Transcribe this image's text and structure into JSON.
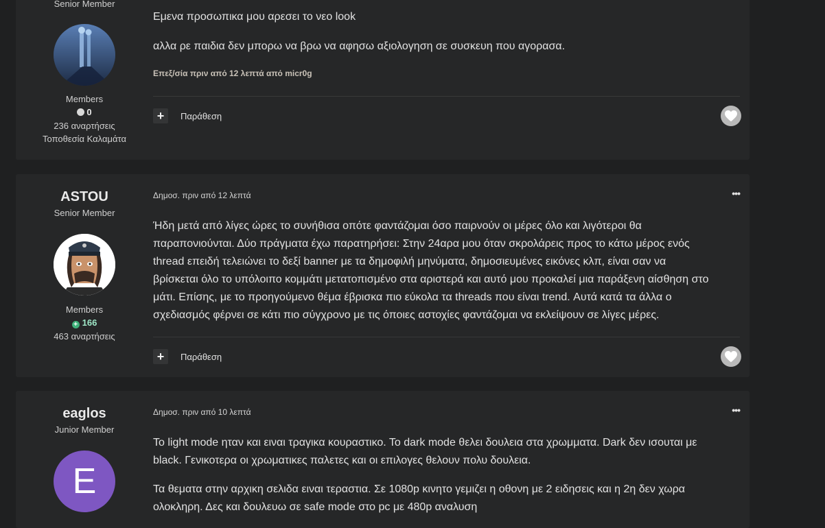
{
  "posts": [
    {
      "author": {
        "title": "Senior Member",
        "group": "Members",
        "rep": "0",
        "posts_count": "236 αναρτήσεις",
        "location": "Τοποθεσία Καλαμάτα"
      },
      "body": [
        "Εμενα προσωπικα μου αρεσει το νεο look",
        "αλλα ρε παιδια δεν μπορω να βρω να αφησω αξιολογηση σε συσκευη που αγορασα."
      ],
      "edited": "Επεξ/σία πριν από 12 λεπτά από micr0g",
      "quote_label": "Παράθεση"
    },
    {
      "author": {
        "name": "ASTOU",
        "title": "Senior Member",
        "group": "Members",
        "rep": "166",
        "posts_count": "463 αναρτήσεις"
      },
      "meta": "Δημοσ. πριν από 12 λεπτά",
      "body_lines": [
        "Ήδη μετά από λίγες ώρες το συνήθισα οπότε φαντάζομαι όσο παιρνούν οι μέρες όλο και λιγότεροι θα",
        "παραπονιούνται. Δύο πράγματα έχω παρατηρήσει: Στην 24αρα μου όταν σκρολάρεις προς το κάτω μέρος ενός",
        "thread  επειδή τελειώνει το δεξί banner με τα δημοφιλή μηνύματα, δημοσιευμένες εικόνες κλπ, είναι σαν να",
        "βρίσκεται όλο το υπόλοιπο κομμάτι μετατοπισμένο στα αριστερά και αυτό μου προκαλεί μια παράξενη αίσθηση στο",
        "μάτι. Επίσης, με το προηγούμενο θέμα έβρισκα πιο εύκολα τα threads που είναι trend. Αυτά κατά τα άλλα ο",
        "σχεδιασμός φέρνει σε κάτι πιο σύγχρονο με τις όποιες αστοχίες φαντάζομαι να εκλείψουν σε λίγες μέρες."
      ],
      "quote_label": "Παράθεση"
    },
    {
      "author": {
        "name": "eaglos",
        "title": "Junior Member",
        "avatar_letter": "E"
      },
      "meta": "Δημοσ. πριν από 10 λεπτά",
      "para1_lines": [
        "Το light mode ηταν και ειναι τραγικα κουραστικο. Το dark mode θελει δουλεια στα χρωμματα. Dark δεν ισουται με",
        "black. Γενικοτερα οι χρωματικες παλετες και οι επιλογες θελουν πολυ δουλεια."
      ],
      "para2_lines": [
        "Τα θεματα στην αρχικη σελιδα ειναι τεραστια. Σε 1080p κινητο γεμιζει η οθονη με 2 ειδησεις και η 2η δεν χωρα",
        "ολοκληρη. Δες και δουλευω σε safe mode στο pc με 480p αναλυση"
      ]
    }
  ],
  "colors": {
    "rep_positive": "#3fb07a",
    "avatar_letter_bg": "#7e57c2",
    "like_bg": "#b9b9b9"
  },
  "icons": {
    "more": "ellipsis-icon",
    "like": "heart-icon",
    "multiquote": "plus-icon"
  }
}
